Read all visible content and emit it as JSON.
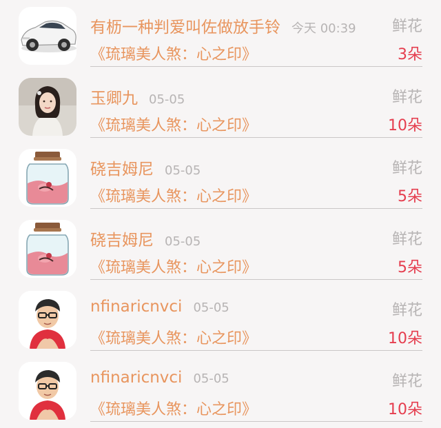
{
  "rows": [
    {
      "name": "有枥一种判爱叫佐做放手铃",
      "time": "今天 00:39",
      "gift": "鲜花",
      "book": "《琉璃美人煞：心之印》",
      "count": "3朵",
      "avatar": "car-avatar"
    },
    {
      "name": "玉卿九",
      "time": "05-05",
      "gift": "鲜花",
      "book": "《琉璃美人煞：心之印》",
      "count": "10朵",
      "avatar": "woman-avatar"
    },
    {
      "name": "硗吉姆尼",
      "time": "05-05",
      "gift": "鲜花",
      "book": "《琉璃美人煞：心之印》",
      "count": "5朵",
      "avatar": "jar-avatar"
    },
    {
      "name": "硗吉姆尼",
      "time": "05-05",
      "gift": "鲜花",
      "book": "《琉璃美人煞：心之印》",
      "count": "5朵",
      "avatar": "jar-avatar"
    },
    {
      "name": "nfinaricnvci",
      "time": "05-05",
      "gift": "鲜花",
      "book": "《琉璃美人煞：心之印》",
      "count": "10朵",
      "avatar": "cartoon-man-avatar"
    },
    {
      "name": "nfinaricnvci",
      "time": "05-05",
      "gift": "鲜花",
      "book": "《琉璃美人煞：心之印》",
      "count": "10朵",
      "avatar": "cartoon-man-avatar"
    }
  ]
}
